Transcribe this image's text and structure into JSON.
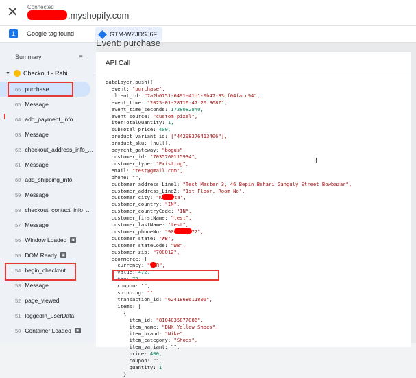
{
  "header": {
    "connected_label": "Connected",
    "domain_suffix": ".myshopify.com"
  },
  "tagbar": {
    "count": "1",
    "found_label": "Google tag found",
    "container_id": "GTM-WZJDSJ6F"
  },
  "sidebar": {
    "summary_label": "Summary",
    "page_label": "Checkout - Rahi",
    "events": [
      {
        "n": "66",
        "label": "purchase",
        "selected": true
      },
      {
        "n": "65",
        "label": "Message"
      },
      {
        "n": "64",
        "label": "add_payment_info"
      },
      {
        "n": "63",
        "label": "Message"
      },
      {
        "n": "62",
        "label": "checkout_address_info_..."
      },
      {
        "n": "61",
        "label": "Message"
      },
      {
        "n": "60",
        "label": "add_shipping_info"
      },
      {
        "n": "59",
        "label": "Message"
      },
      {
        "n": "58",
        "label": "checkout_contact_info_..."
      },
      {
        "n": "57",
        "label": "Message"
      },
      {
        "n": "56",
        "label": "Window Loaded"
      },
      {
        "n": "55",
        "label": "DOM Ready"
      },
      {
        "n": "54",
        "label": "begin_checkout"
      },
      {
        "n": "53",
        "label": "Message"
      },
      {
        "n": "52",
        "label": "page_viewed"
      },
      {
        "n": "51",
        "label": "loggedIn_userData"
      },
      {
        "n": "50",
        "label": "Container Loaded"
      }
    ]
  },
  "main": {
    "event_title": "Event: purchase",
    "panel_title": "API Call"
  },
  "code": {
    "l01": "dataLayer.push({",
    "l02": "  event: ",
    "l02v": "\"purchase\",",
    "l03": "  client_id: ",
    "l03v": "\"7a2b0751-6491-41d1-9b47-83cf04facc94\",",
    "l04": "  event_time: ",
    "l04v": "\"2025-01-28T16:47:20.368Z\",",
    "l05": "  event_time_seconds: ",
    "l05v": "1738082840,",
    "l06": "  event_source: ",
    "l06v": "\"custom_pixel\",",
    "l07": "  itemTotalQuantity: ",
    "l07v": "1,",
    "l08": "  subTotal_price: ",
    "l08v": "400,",
    "l09": "  product_variant_id: ",
    "l09v": "[\"44298376413406\"],",
    "l10": "  product_sku: [null],",
    "l11": "  payment_gateway: ",
    "l11v": "\"bogus\",",
    "l12": "  customer_id: ",
    "l12v": "\"7035760115934\",",
    "l13": "  customer_type: ",
    "l13v": "\"Existing\",",
    "l14": "  email: ",
    "l14v": "\"test@gmail.com\",",
    "l15": "  phone: \"\",",
    "l16": "  customer_address_Line1: ",
    "l16v": "\"Test Master 3, 46 Bepin Behari Ganguly Street Bowbazar\",",
    "l17": "  customer_address_Line2: ",
    "l17v": "\"1st Floor, Room No\",",
    "l18a": "  customer_city: ",
    "l18b": "\"K",
    "l18c": "ta\",",
    "l19": "  customer_country: ",
    "l19v": "\"IN\",",
    "l20": "  customer_countryCode: ",
    "l20v": "\"IN\",",
    "l21": "  customer_firstName: ",
    "l21v": "\"test\",",
    "l22": "  customer_lastName: ",
    "l22v": "\"test\",",
    "l23a": "  customer_phoneNo: ",
    "l23b": "\"90",
    "l23c": "72\",",
    "l24": "  customer_state: ",
    "l24v": "\"WB\",",
    "l25": "  customer_stateCode: ",
    "l25v": "\"WB\",",
    "l26": "  customer_zip: ",
    "l26v": "\"700012\",",
    "l27": "  ecommerce: {",
    "l28a": "    currency: ",
    "l28b": "\"",
    "l28c": "R\",",
    "l29": "    value: ",
    "l29v": "472,",
    "l30": "    tax: ",
    "l30v": "72,",
    "l31": "    coupon: \"\",",
    "l32": "    shipping: ",
    "l32v": "\"\"",
    "l33": "    transaction_id: ",
    "l33v": "\"6241868611806\",",
    "l34": "    items: [",
    "l35": "      {",
    "l36": "        item_id: ",
    "l36v": "\"8104035877086\",",
    "l37": "        item_name: ",
    "l37v": "\"DNK Yellow Shoes\",",
    "l38": "        item_brand: ",
    "l38v": "\"Nike\",",
    "l39": "        item_category: ",
    "l39v": "\"Shoes\",",
    "l40": "        item_variant: \"\",",
    "l41": "        price: ",
    "l41v": "400,",
    "l42": "        coupon: \"\",",
    "l43": "        quantity: ",
    "l43v": "1",
    "l44": "      }"
  },
  "colors": {
    "accent": "#1a73e8",
    "highlight_box": "#e53935",
    "selected_bg": "#d2e3fc",
    "redaction": "#ff0000"
  },
  "icons": {
    "close": "close-icon",
    "clear": "clear-all-icon",
    "gtm": "gtm-diamond-icon",
    "page": "page-dot-icon"
  }
}
